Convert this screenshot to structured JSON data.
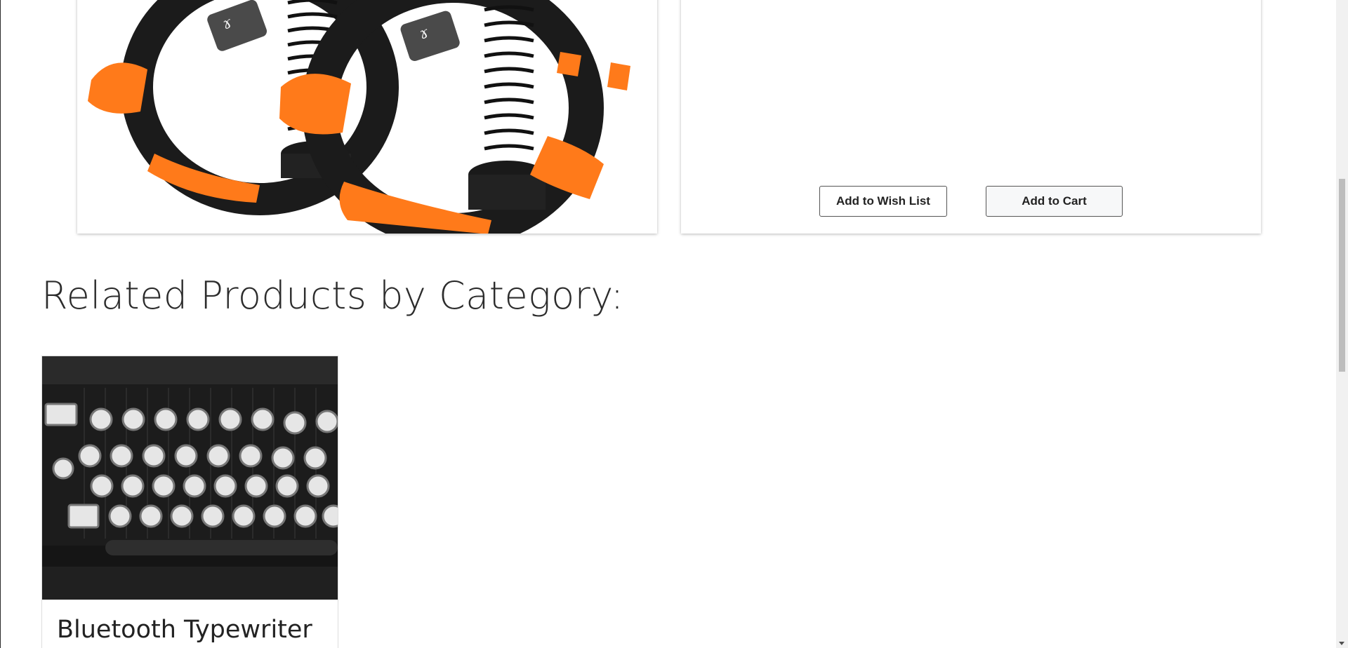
{
  "product": {
    "image_alt": "Hand grip strengtheners"
  },
  "actions": {
    "wishlist_label": "Add to Wish List",
    "cart_label": "Add to Cart"
  },
  "related": {
    "title": "Related Products by Category:",
    "items": [
      {
        "name": "Bluetooth Typewriter"
      }
    ]
  },
  "colors": {
    "accent_orange": "#ff7a1a",
    "grip_black": "#1b1b1b"
  }
}
